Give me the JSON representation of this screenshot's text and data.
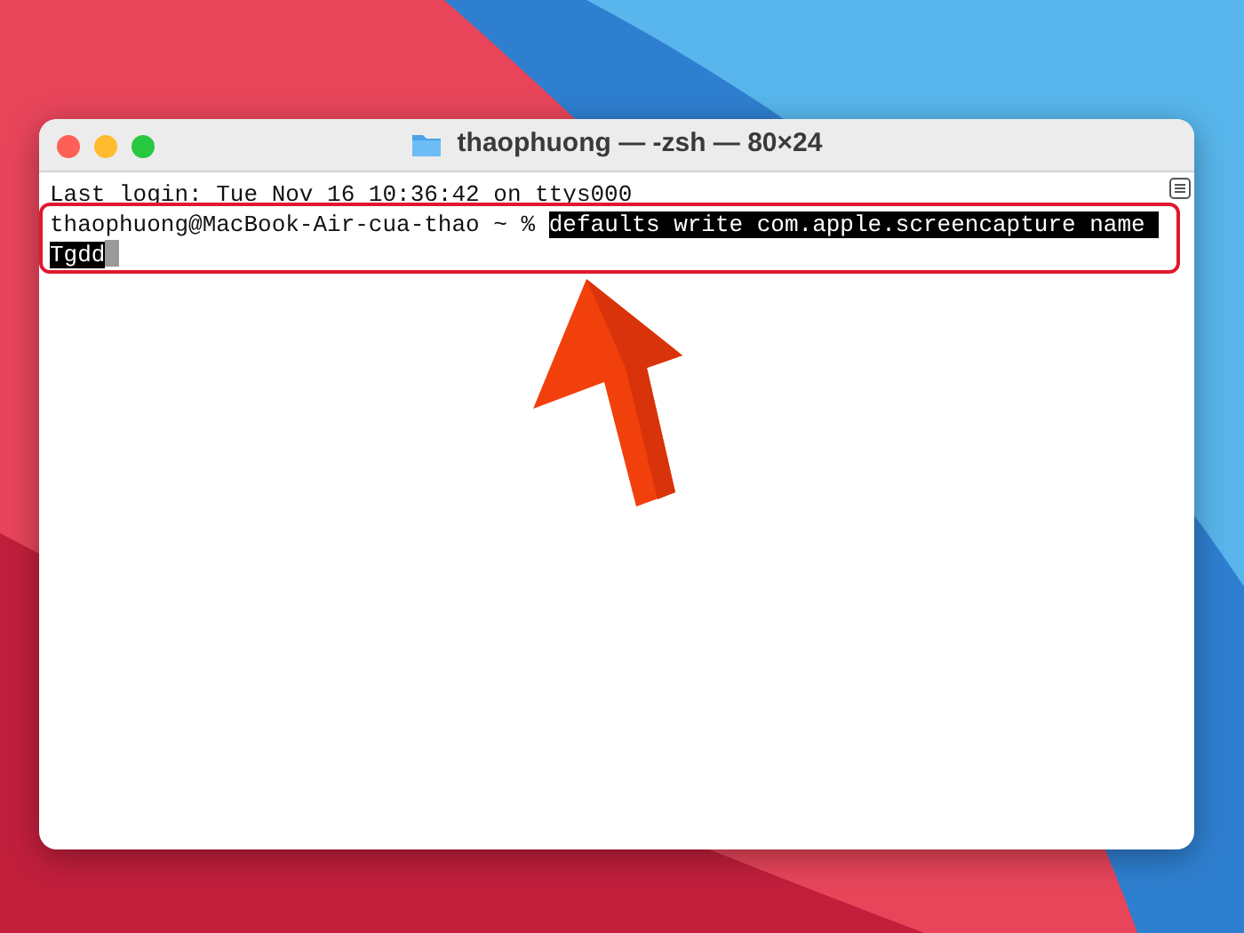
{
  "window": {
    "title": "thaophuong — -zsh — 80×24"
  },
  "terminal": {
    "lines": [
      {
        "text": "Last login: Tue Nov 16 10:36:42 on ttys000",
        "selected": false
      },
      {
        "prompt": "thaophuong@MacBook-Air-cua-thao ~ % ",
        "text": "defaults write com.apple.screencapture name ",
        "selected": true
      },
      {
        "text": "Tgdd",
        "selected": true,
        "cursor": true
      }
    ]
  }
}
